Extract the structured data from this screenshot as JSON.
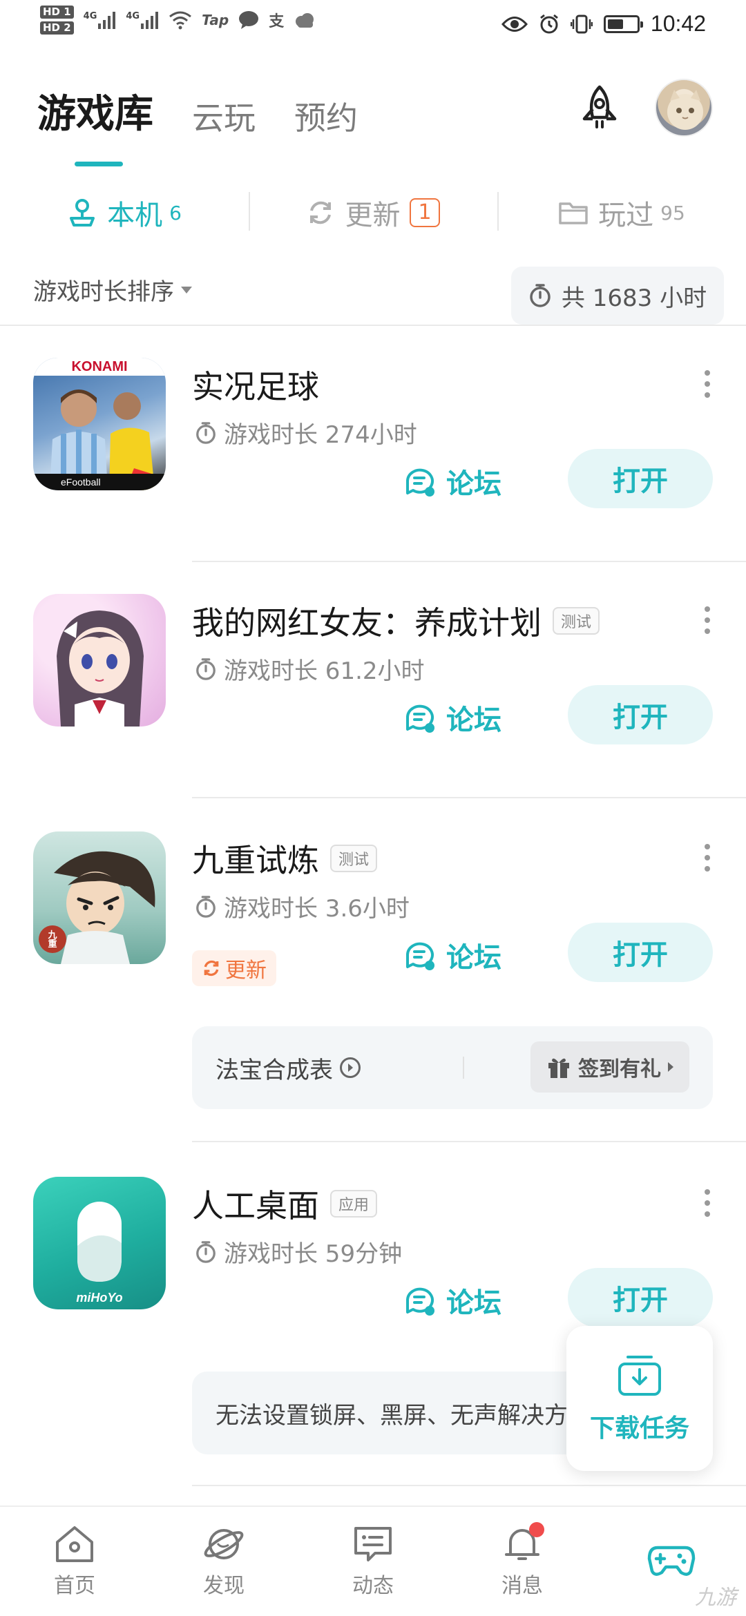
{
  "status_bar": {
    "hd1": "HD 1",
    "hd2": "HD 2",
    "sig1": "4G",
    "sig2": "4G",
    "tap_label": "Tap",
    "alipay_label": "支",
    "time": "10:42",
    "battery_level": 0.55
  },
  "header": {
    "tabs": [
      {
        "label": "游戏库",
        "active": true
      },
      {
        "label": "云玩",
        "active": false
      },
      {
        "label": "预约",
        "active": false
      }
    ]
  },
  "subtabs": [
    {
      "label": "本机",
      "count": "6"
    },
    {
      "label": "更新",
      "count": "1"
    },
    {
      "label": "玩过",
      "count": "95"
    }
  ],
  "sort": {
    "label": "游戏时长排序",
    "total": "共 1683 小时"
  },
  "games": [
    {
      "title": "实况足球",
      "tag": "",
      "time": "游戏时长 274小时",
      "forum": "论坛",
      "open": "打开",
      "icon_brand": "KONAMI",
      "icon_sub": "eFootball"
    },
    {
      "title": "我的网红女友：养成计划",
      "tag": "测试",
      "time": "游戏时长 61.2小时",
      "forum": "论坛",
      "open": "打开"
    },
    {
      "title": "九重试炼",
      "tag": "测试",
      "time": "游戏时长 3.6小时",
      "forum": "论坛",
      "open": "打开",
      "update": "更新",
      "icon_mark": "九重",
      "extra": {
        "label": "法宝合成表",
        "action": "签到有礼"
      }
    },
    {
      "title": "人工桌面",
      "tag": "应用",
      "time": "游戏时长 59分钟",
      "forum": "论坛",
      "open": "打开",
      "icon_brand": "miHoYo",
      "extra": {
        "label": "无法设置锁屏、黑屏、无声解决方"
      }
    }
  ],
  "download_float": {
    "label": "下载任务"
  },
  "bottom_nav": [
    {
      "label": "首页",
      "icon": "home-icon"
    },
    {
      "label": "发现",
      "icon": "planet-icon"
    },
    {
      "label": "动态",
      "icon": "message-card-icon"
    },
    {
      "label": "消息",
      "icon": "bell-icon"
    },
    {
      "label": "",
      "icon": "gamepad-icon"
    }
  ],
  "watermark": "九游",
  "colors": {
    "accent": "#1fb5bd",
    "update": "#f0753f",
    "badge_dot": "#f04c4c"
  }
}
